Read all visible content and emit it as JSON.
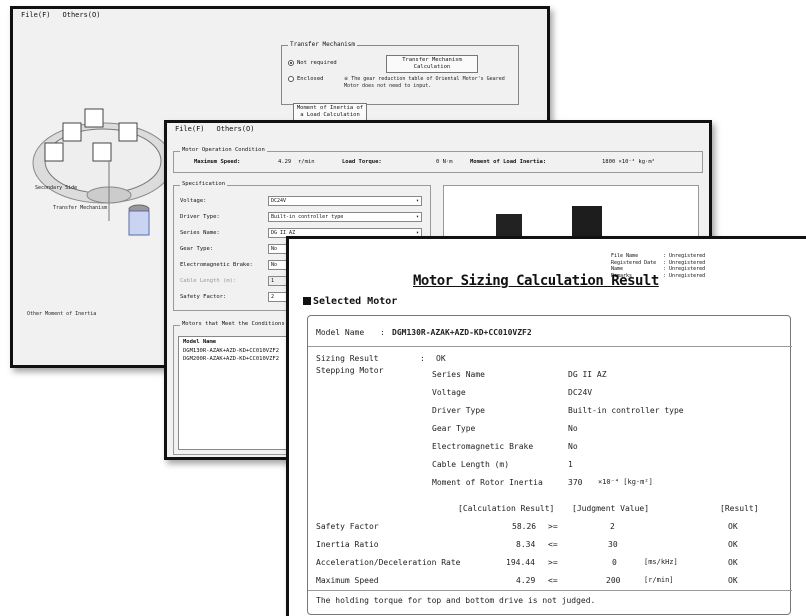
{
  "window1": {
    "menu": [
      "File(F)",
      "Others(O)"
    ],
    "transfer_mechanism": {
      "title": "Transfer Mechanism",
      "options": [
        "Not required",
        "Enclosed"
      ],
      "calc_button": "Transfer Mechanism Calculation",
      "note": "※ The gear reduction table of Oriental Motor's Geared Motor does not need to input."
    },
    "moi_button": "Moment of Inertia of a Load Calculation",
    "labels": {
      "secondary": "Secondary Side",
      "transfer": "Transfer Mechanism",
      "other_moi": "Other Moment of Inertia"
    }
  },
  "window2": {
    "menu": [
      "File(F)",
      "Others(O)"
    ],
    "motor_operation": {
      "title": "Motor Operation Condition",
      "max_speed_label": "Maximum Speed:",
      "max_speed_value": "4.29",
      "max_speed_unit": "r/min",
      "load_torque_label": "Load Torque:",
      "load_torque_value": "0 N·m",
      "moi_label": "Moment of Load Inertia:",
      "moi_value": "1800 ×10⁻⁴ kg·m²"
    },
    "specification": {
      "title": "Specification",
      "fields": [
        {
          "label": "Voltage:",
          "value": "DC24V"
        },
        {
          "label": "Driver Type:",
          "value": "Built-in controller type"
        },
        {
          "label": "Series Name:",
          "value": "DG II AZ"
        },
        {
          "label": "Gear Type:",
          "value": "No"
        },
        {
          "label": "Electromagnetic Brake:",
          "value": "No"
        },
        {
          "label": "Cable Length (m):",
          "value": "1"
        },
        {
          "label": "Safety Factor:",
          "value": "2"
        }
      ]
    },
    "results_box": {
      "title": "Motors that Meet the Conditions",
      "header": "Model Name",
      "rows": [
        "DGM130R-AZAK+AZD-KD+CC010VZF2",
        "DGM200R-AZAK+AZD-KD+CC010VZF2"
      ]
    }
  },
  "report": {
    "title": "Motor Sizing Calculation Result",
    "meta": [
      {
        "k": "File Name",
        "v": "Unregistered"
      },
      {
        "k": "Registered Date",
        "v": "Unregistered"
      },
      {
        "k": "Name",
        "v": "Unregistered"
      },
      {
        "k": "Remarks",
        "v": "Unregistered"
      }
    ],
    "section": "Selected Motor",
    "model_label": "Model Name",
    "model_colon": ":",
    "model_value": "DGM130R-AZAK+AZD-KD+CC010VZF2",
    "sizing_label": "Sizing Result",
    "sizing_colon": ":",
    "sizing_value": "OK",
    "motor_type": "Stepping Motor",
    "details": [
      {
        "k": "Series Name",
        "v": "DG II AZ"
      },
      {
        "k": "Voltage",
        "v": "DC24V"
      },
      {
        "k": "Driver Type",
        "v": "Built-in controller type"
      },
      {
        "k": "Gear Type",
        "v": "No"
      },
      {
        "k": "Electromagnetic Brake",
        "v": "No"
      },
      {
        "k": "Cable Length (m)",
        "v": "1"
      },
      {
        "k": "Moment of Rotor Inertia",
        "v": "370",
        "unit": "×10⁻⁴ [kg·m²]"
      }
    ],
    "col_headers": [
      "[Calculation Result]",
      "[Judgment Value]",
      "[Result]"
    ],
    "rows": [
      {
        "k": "Safety Factor",
        "calc": "58.26",
        "op": ">=",
        "judge": "2",
        "unit": "",
        "res": "OK"
      },
      {
        "k": "Inertia Ratio",
        "calc": "8.34",
        "op": "<=",
        "judge": "30",
        "unit": "",
        "res": "OK"
      },
      {
        "k": "Acceleration/Deceleration Rate",
        "calc": "194.44",
        "op": ">=",
        "judge": "0",
        "unit": "[ms/kHz]",
        "res": "OK"
      },
      {
        "k": "Maximum Speed",
        "calc": "4.29",
        "op": "<=",
        "judge": "200",
        "unit": "[r/min]",
        "res": "OK"
      }
    ],
    "footer": "The holding torque for top and bottom drive is not judged."
  }
}
